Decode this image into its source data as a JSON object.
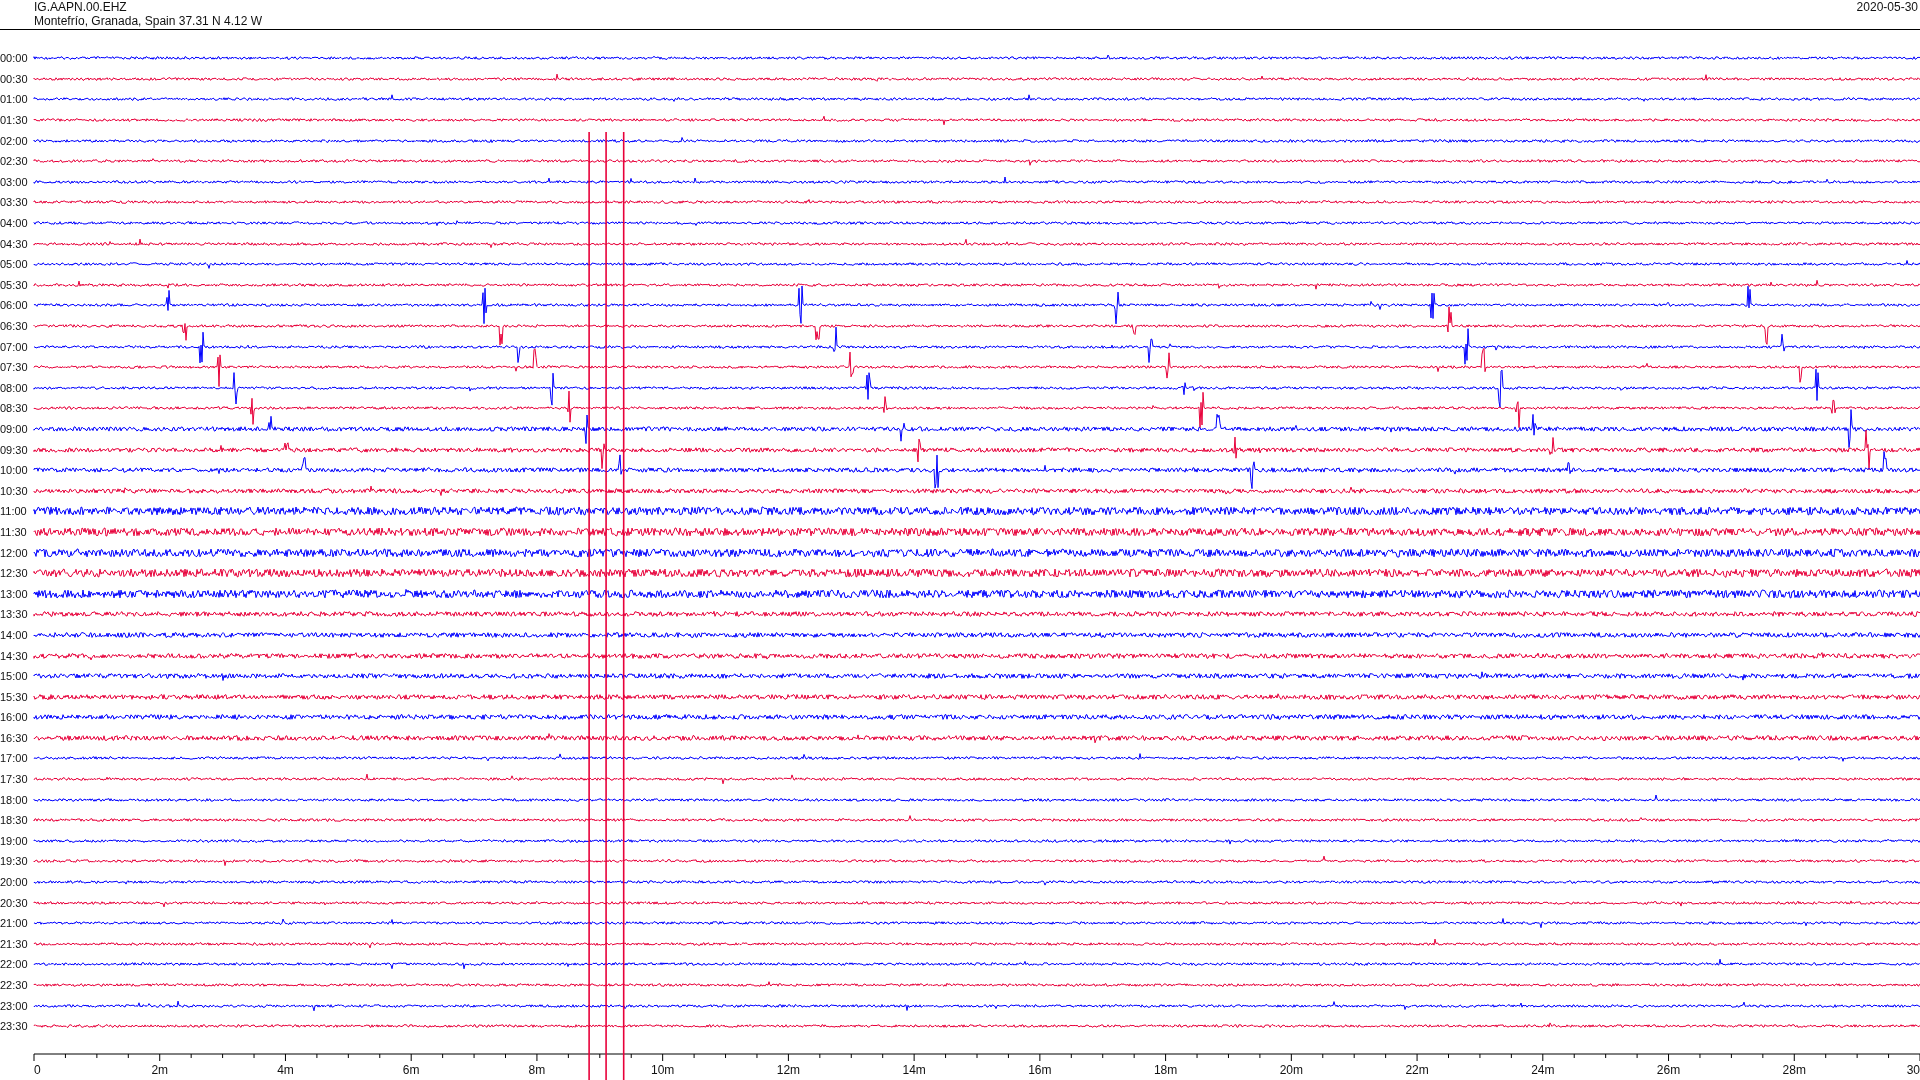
{
  "header": {
    "station": "IG.AAPN.00.EHZ",
    "location": "Montefrío, Granada, Spain  37.31 N 4.12 W",
    "date": "2020-05-30"
  },
  "rows": [
    {
      "label": "00:00",
      "color": "#0000ff"
    },
    {
      "label": "00:30",
      "color": "#e8003a"
    },
    {
      "label": "01:00",
      "color": "#0000ff"
    },
    {
      "label": "01:30",
      "color": "#e8003a"
    },
    {
      "label": "02:00",
      "color": "#0000ff"
    },
    {
      "label": "02:30",
      "color": "#e8003a"
    },
    {
      "label": "03:00",
      "color": "#0000ff"
    },
    {
      "label": "03:30",
      "color": "#e8003a"
    },
    {
      "label": "04:00",
      "color": "#0000ff"
    },
    {
      "label": "04:30",
      "color": "#e8003a"
    },
    {
      "label": "05:00",
      "color": "#0000ff"
    },
    {
      "label": "05:30",
      "color": "#e8003a"
    },
    {
      "label": "06:00",
      "color": "#0000ff"
    },
    {
      "label": "06:30",
      "color": "#e8003a"
    },
    {
      "label": "07:00",
      "color": "#0000ff"
    },
    {
      "label": "07:30",
      "color": "#e8003a"
    },
    {
      "label": "08:00",
      "color": "#0000ff"
    },
    {
      "label": "08:30",
      "color": "#e8003a"
    },
    {
      "label": "09:00",
      "color": "#0000ff"
    },
    {
      "label": "09:30",
      "color": "#e8003a"
    },
    {
      "label": "10:00",
      "color": "#0000ff"
    },
    {
      "label": "10:30",
      "color": "#e8003a"
    },
    {
      "label": "11:00",
      "color": "#0000ff"
    },
    {
      "label": "11:30",
      "color": "#e8003a"
    },
    {
      "label": "12:00",
      "color": "#0000ff"
    },
    {
      "label": "12:30",
      "color": "#e8003a"
    },
    {
      "label": "13:00",
      "color": "#0000ff"
    },
    {
      "label": "13:30",
      "color": "#e8003a"
    },
    {
      "label": "14:00",
      "color": "#0000ff"
    },
    {
      "label": "14:30",
      "color": "#e8003a"
    },
    {
      "label": "15:00",
      "color": "#0000ff"
    },
    {
      "label": "15:30",
      "color": "#e8003a"
    },
    {
      "label": "16:00",
      "color": "#0000ff"
    },
    {
      "label": "16:30",
      "color": "#e8003a"
    },
    {
      "label": "17:00",
      "color": "#0000ff"
    },
    {
      "label": "17:30",
      "color": "#e8003a"
    },
    {
      "label": "18:00",
      "color": "#0000ff"
    },
    {
      "label": "18:30",
      "color": "#e8003a"
    },
    {
      "label": "19:00",
      "color": "#0000ff"
    },
    {
      "label": "19:30",
      "color": "#e8003a"
    },
    {
      "label": "20:00",
      "color": "#0000ff"
    },
    {
      "label": "20:30",
      "color": "#e8003a"
    },
    {
      "label": "21:00",
      "color": "#0000ff"
    },
    {
      "label": "21:30",
      "color": "#e8003a"
    },
    {
      "label": "22:00",
      "color": "#0000ff"
    },
    {
      "label": "22:30",
      "color": "#e8003a"
    },
    {
      "label": "23:00",
      "color": "#0000ff"
    },
    {
      "label": "23:30",
      "color": "#e8003a"
    }
  ],
  "x_axis": {
    "labels": [
      "0",
      "2m",
      "4m",
      "6m",
      "8m",
      "10m",
      "12m",
      "14m",
      "16m",
      "18m",
      "20m",
      "22m",
      "24m",
      "26m",
      "28m",
      "30"
    ]
  }
}
